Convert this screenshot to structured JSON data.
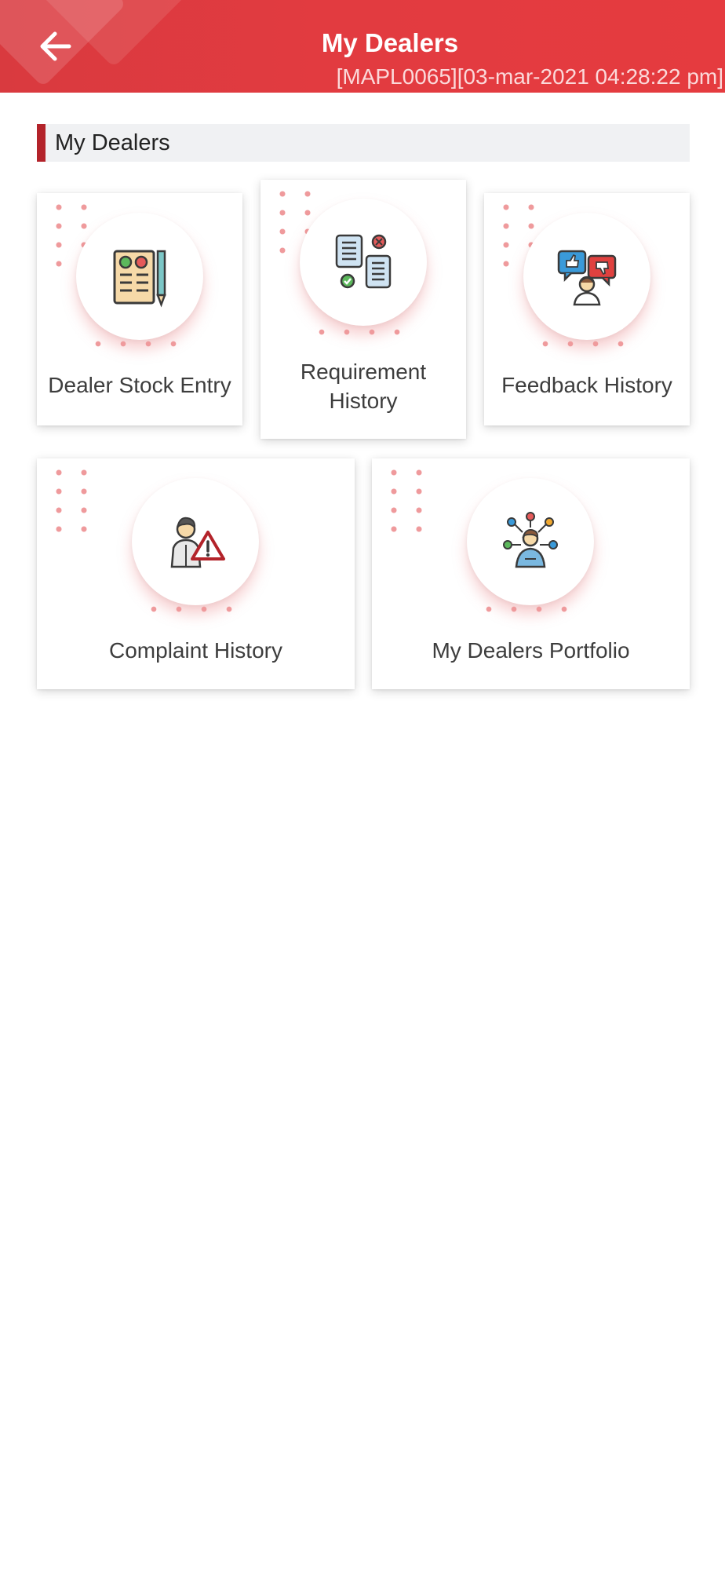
{
  "header": {
    "title": "My Dealers",
    "subtitle": "[MAPL0065][03-mar-2021 04:28:22 pm]",
    "back_icon": "arrow-left-icon"
  },
  "section": {
    "title": "My Dealers"
  },
  "tiles": [
    {
      "label": "Dealer Stock Entry",
      "icon": "stock-sheet-pencil-icon"
    },
    {
      "label": "Requirement History",
      "icon": "document-flow-icon"
    },
    {
      "label": "Feedback History",
      "icon": "feedback-thumbs-icon"
    },
    {
      "label": "Complaint History",
      "icon": "person-warning-icon"
    },
    {
      "label": "My Dealers Portfolio",
      "icon": "person-network-icon"
    }
  ],
  "colors": {
    "app_bar": "#e23b40",
    "accent_bar": "#b3232a",
    "dot": "#ef9a9c"
  }
}
